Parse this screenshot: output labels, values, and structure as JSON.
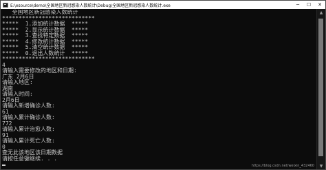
{
  "window": {
    "title": "E:\\esource\\demo\\全国地区新冠感染人数统计\\Debug\\全国地区新冠感染人数统计.exe",
    "icons": {
      "app": "console-icon",
      "minimize": "minimize-icon",
      "maximize": "maximize-icon",
      "close": "close-icon"
    }
  },
  "console": {
    "lines": [
      "   全国地区新冠感染人数统计",
      "****************************",
      "*****  1.添加统计数据  *****",
      "*****  2.显示统计数据  *****",
      "*****  3.查找特定数据  *****",
      "*****  4.修改统计数据  *****",
      "*****  5.清空统计数据  *****",
      "*****  0.退出人数统计  *****",
      "****************************",
      "4",
      "请输入需要修改的地区和日期:",
      "广东 2月6日",
      "请输入地区:",
      "湖南",
      "请输入时间:",
      "2月6日",
      "请输入新增确诊人数:",
      "61",
      "请输入累计确诊人数:",
      "772",
      "请输入累计治愈人数:",
      "91",
      "请输入累计死亡人数:",
      "0",
      "查无此该地区该日期数据",
      "请按任意键继续. . . "
    ]
  },
  "watermark": "https://blog.csdn.net/weixin_432460"
}
